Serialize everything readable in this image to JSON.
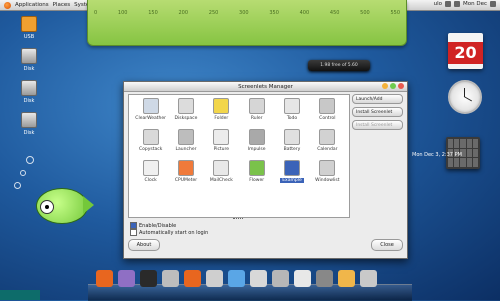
{
  "top_panel": {
    "menus": [
      "Applications",
      "Places",
      "System"
    ],
    "status_text": "Mon Dec",
    "user_text": "ulo"
  },
  "ruler": {
    "ticks": [
      "0",
      "100",
      "150",
      "200",
      "250",
      "300",
      "350",
      "400",
      "450",
      "500",
      "550"
    ]
  },
  "desktop_icons": [
    {
      "label": "USB"
    },
    {
      "label": "Disk"
    },
    {
      "label": "Disk"
    },
    {
      "label": "Disk"
    }
  ],
  "disk_widget": {
    "text": "1.98 free of 5.60"
  },
  "calendar_widget": {
    "day": "20"
  },
  "month_widget_label": "Mon Dec 3, 2:37 PM",
  "window": {
    "title": "Screenlets Manager",
    "items": [
      {
        "label": "ClearWeather"
      },
      {
        "label": "Diskspace"
      },
      {
        "label": "Folder"
      },
      {
        "label": "Ruler"
      },
      {
        "label": "Todo"
      },
      {
        "label": "Control"
      },
      {
        "label": "Copystack"
      },
      {
        "label": "Launcher"
      },
      {
        "label": "Picture"
      },
      {
        "label": "Impulse"
      },
      {
        "label": "Battery"
      },
      {
        "label": "Calendar"
      },
      {
        "label": "Clock"
      },
      {
        "label": "CPUMeter"
      },
      {
        "label": "MailCheck"
      },
      {
        "label": "Flower"
      },
      {
        "label": "Example"
      },
      {
        "label": "Windowlist"
      }
    ],
    "selected_index": 16,
    "side_buttons": [
      "Launch/Add",
      "Install Screenlet",
      "Install Screenlet"
    ],
    "checkboxes": [
      {
        "label": "Enable/Disable",
        "checked": true
      },
      {
        "label": "Automatically start on login",
        "checked": false
      }
    ],
    "about_label": "About",
    "close_label": "Close"
  },
  "dock_items": [
    "firefox",
    "pidgin",
    "monitor",
    "terminal",
    "firefox",
    "drive",
    "folder",
    "apple",
    "settings",
    "calendar",
    "camera",
    "fish",
    "trash"
  ]
}
